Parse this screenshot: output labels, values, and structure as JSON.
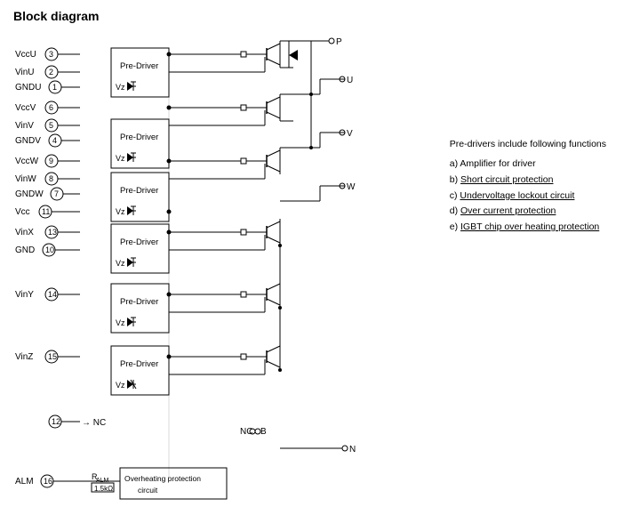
{
  "title": "Block diagram",
  "legend": {
    "intro": "Pre-drivers include following functions",
    "items": [
      {
        "label": "a) Amplifier for driver"
      },
      {
        "label": "b) Short circuit protection",
        "underline": "Short circuit protection"
      },
      {
        "label": "c) Undervoltage lockout circuit",
        "underline": "Undervoltage lockout circuit"
      },
      {
        "label": "d) Over current protection",
        "underline": "Over current protection"
      },
      {
        "label": "e) IGBT chip over heating protection",
        "underline": "IGBT chip over heating protection"
      }
    ]
  },
  "pins": {
    "left": [
      {
        "name": "VccU",
        "num": "3"
      },
      {
        "name": "VinU",
        "num": "2"
      },
      {
        "name": "GNDU",
        "num": "1"
      },
      {
        "name": "VccV",
        "num": "6"
      },
      {
        "name": "VinV",
        "num": "5"
      },
      {
        "name": "GNDV",
        "num": "4"
      },
      {
        "name": "VccW",
        "num": "9"
      },
      {
        "name": "VinW",
        "num": "8"
      },
      {
        "name": "GNDW",
        "num": "7"
      },
      {
        "name": "Vcc",
        "num": "11"
      },
      {
        "name": "VinX",
        "num": "13"
      },
      {
        "name": "GND",
        "num": "10"
      },
      {
        "name": "VinY",
        "num": "14"
      },
      {
        "name": "VinZ",
        "num": "15"
      },
      {
        "name": "ALM",
        "num": "16"
      }
    ]
  }
}
